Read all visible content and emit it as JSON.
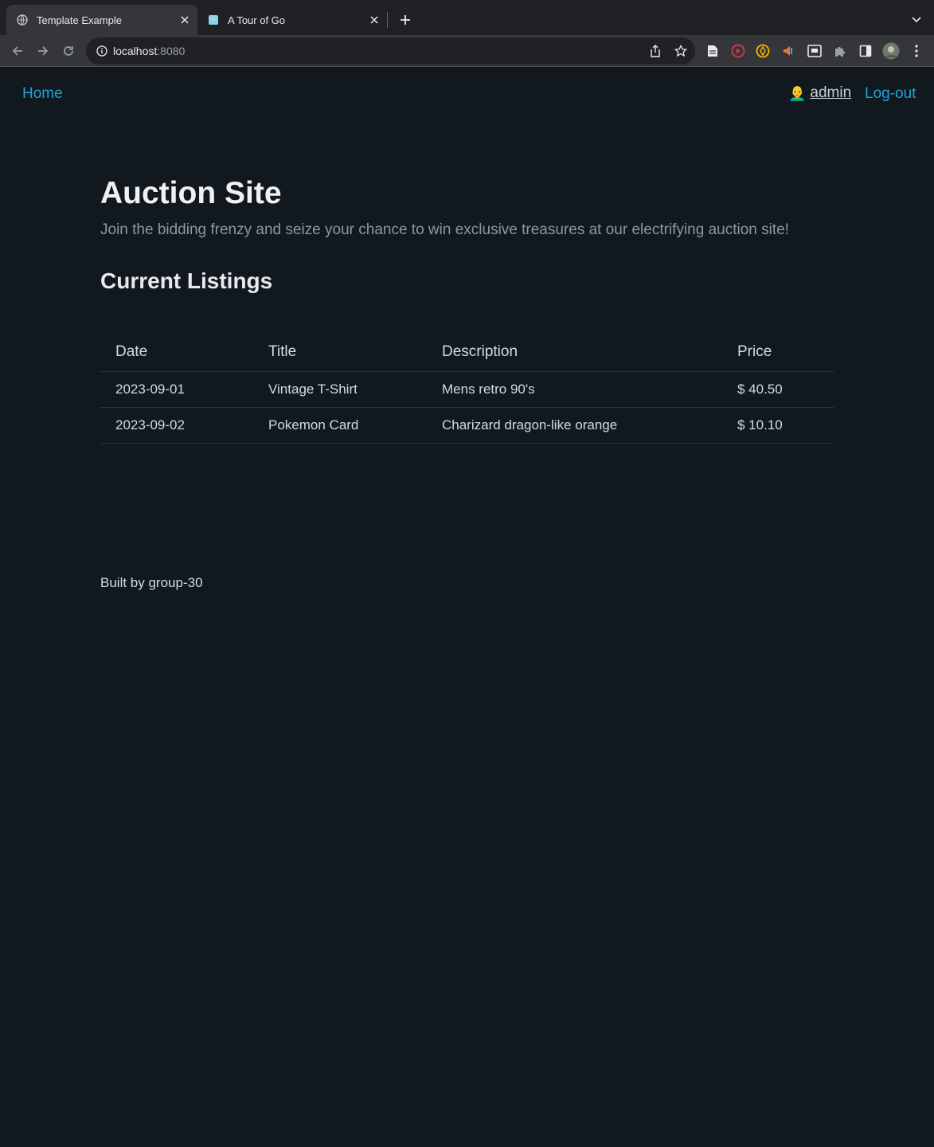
{
  "browser": {
    "tabs": [
      {
        "title": "Template Example",
        "active": true,
        "favicon": "globe-icon"
      },
      {
        "title": "A Tour of Go",
        "active": false,
        "favicon": "gopher-icon"
      }
    ],
    "address": {
      "host": "localhost",
      "port": ":8080"
    }
  },
  "nav": {
    "home_label": "Home",
    "user_emoji": "👨‍🦲",
    "username": "admin",
    "logout_label": "Log-out"
  },
  "header": {
    "title": "Auction Site",
    "subtitle": "Join the bidding frenzy and seize your chance to win exclusive treasures at our electrifying auction site!"
  },
  "listings": {
    "section_title": "Current Listings",
    "columns": [
      "Date",
      "Title",
      "Description",
      "Price"
    ],
    "rows": [
      {
        "date": "2023-09-01",
        "title": "Vintage T-Shirt",
        "description": "Mens retro 90's",
        "price": "$ 40.50"
      },
      {
        "date": "2023-09-02",
        "title": "Pokemon Card",
        "description": "Charizard dragon-like orange",
        "price": "$ 10.10"
      }
    ]
  },
  "footer": {
    "text": "Built by group-30"
  },
  "colors": {
    "background": "#11191f",
    "link": "#1ba5d8",
    "text": "#d5dbe0",
    "muted": "#8a98a5"
  }
}
